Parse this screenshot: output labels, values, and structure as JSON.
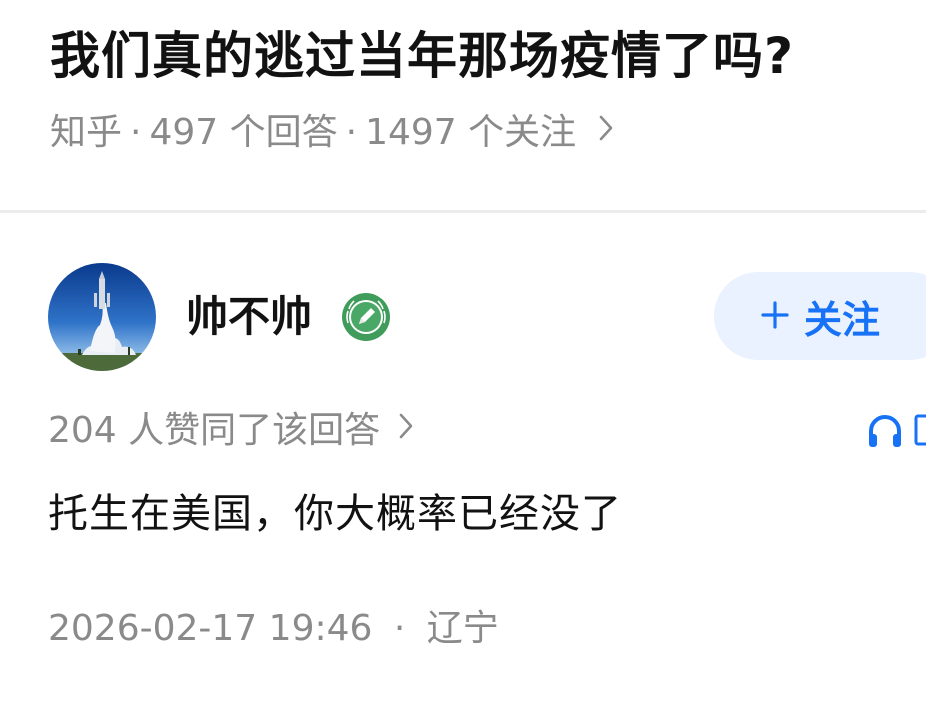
{
  "question": {
    "title": "我们真的逃过当年那场疫情了吗?",
    "source": "知乎",
    "answers": "497 个回答",
    "followers": "1497 个关注",
    "separator": "·",
    "more_icon": "chevron-right-icon"
  },
  "answer": {
    "author": {
      "name": "帅不帅",
      "avatar": "rocket-launch-photo",
      "badge_icon": "pencil-badge-icon"
    },
    "follow_button": {
      "label": "关注",
      "icon": "plus-icon",
      "color": "#1772f6",
      "background": "#eaf2ff"
    },
    "vote_text": "204 人赞同了该回答",
    "listen_icon": "headphones-icon",
    "content": "托生在美国，你大概率已经没了",
    "timestamp": "2026-02-17 19:46",
    "separator": "·",
    "location": "辽宁"
  }
}
